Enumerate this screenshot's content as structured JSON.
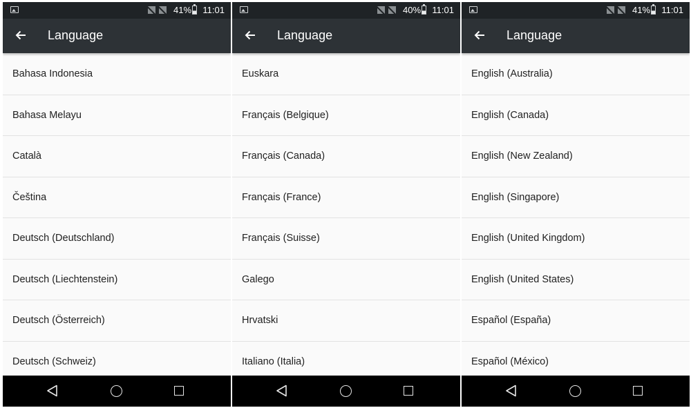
{
  "screens": [
    {
      "status": {
        "battery": "41%",
        "time": "11:01"
      },
      "title": "Language",
      "items": [
        "Bahasa Indonesia",
        "Bahasa Melayu",
        "Català",
        "Čeština",
        "Deutsch (Deutschland)",
        "Deutsch (Liechtenstein)",
        "Deutsch (Österreich)",
        "Deutsch (Schweiz)"
      ]
    },
    {
      "status": {
        "battery": "40%",
        "time": "11:01"
      },
      "title": "Language",
      "items": [
        "Euskara",
        "Français (Belgique)",
        "Français (Canada)",
        "Français (France)",
        "Français (Suisse)",
        "Galego",
        "Hrvatski",
        "Italiano (Italia)"
      ]
    },
    {
      "status": {
        "battery": "41%",
        "time": "11:01"
      },
      "title": "Language",
      "items": [
        "English (Australia)",
        "English (Canada)",
        "English (New Zealand)",
        "English (Singapore)",
        "English (United Kingdom)",
        "English (United States)",
        "Español (España)",
        "Español (México)"
      ]
    }
  ],
  "colors": {
    "status_bar": "#1f2326",
    "app_bar": "#2d3236",
    "list_bg": "#fafafa",
    "nav_bar": "#000000"
  },
  "icons": {
    "status_left": "gallery-icon",
    "status_signal": "no-sim-icon",
    "battery": "battery-icon",
    "back": "arrow-left-icon",
    "nav": [
      "nav-back-icon",
      "nav-home-icon",
      "nav-recent-icon"
    ]
  }
}
